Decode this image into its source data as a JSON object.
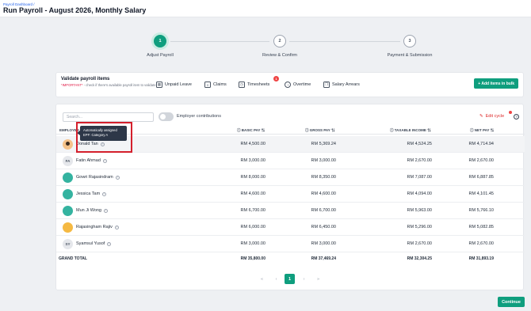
{
  "header": {
    "breadcrumb": "Payroll Dashboard /",
    "title": "Run Payroll - August 2026, Monthly Salary"
  },
  "stepper": [
    {
      "num": "1",
      "label": "Adjust Payroll",
      "state": "active"
    },
    {
      "num": "2",
      "label": "Review & Confirm",
      "state": "todo"
    },
    {
      "num": "3",
      "label": "Payment & Submission",
      "state": "todo"
    }
  ],
  "validate": {
    "title": "Validate payroll items",
    "note_important": "*IMPORTANT*",
    "note_text": " - check if there's available payroll item to validate",
    "items": [
      {
        "label": "Unpaid Leave",
        "icon": "calendar-icon"
      },
      {
        "label": "Claims",
        "icon": "receipt-icon"
      },
      {
        "label": "Timesheets",
        "icon": "clock-card-icon",
        "badge": "1"
      },
      {
        "label": "Overtime",
        "icon": "clock-icon"
      },
      {
        "label": "Salary Arrears",
        "icon": "stack-icon"
      }
    ],
    "bulk_button": "+ Add items in bulk"
  },
  "toolbar": {
    "search_placeholder": "Search...",
    "toggle_label": "Employer contributions",
    "edit_cycle": "Edit cycle",
    "help": "?"
  },
  "table": {
    "columns": [
      "EMPLOYEE",
      "BASIC PAY",
      "GROSS PAY",
      "TAXABLE INCOME",
      "NET PAY"
    ],
    "rows": [
      {
        "name": "Donald Tan",
        "avatar": "photo",
        "initials": "",
        "basic": "RM 4,500.00",
        "gross": "RM 5,369.24",
        "taxable": "RM 4,524.25",
        "net": "RM 4,714.94"
      },
      {
        "name": "Fatin Ahmad",
        "avatar": "initials",
        "initials": "FA",
        "basic": "RM 3,000.00",
        "gross": "RM 3,000.00",
        "taxable": "RM 2,670.00",
        "net": "RM 2,670.00"
      },
      {
        "name": "Gowri Rajasindram",
        "avatar": "teal",
        "initials": "",
        "basic": "RM 8,000.00",
        "gross": "RM 8,350.00",
        "taxable": "RM 7,087.00",
        "net": "RM 6,887.85"
      },
      {
        "name": "Jessica Tam",
        "avatar": "teal",
        "initials": "",
        "basic": "RM 4,600.00",
        "gross": "RM 4,600.00",
        "taxable": "RM 4,094.00",
        "net": "RM 4,101.45"
      },
      {
        "name": "Mun Ji Wong",
        "avatar": "teal",
        "initials": "",
        "basic": "RM 6,700.00",
        "gross": "RM 6,700.00",
        "taxable": "RM 5,963.00",
        "net": "RM 5,766.10"
      },
      {
        "name": "Rajasingham Rajiv",
        "avatar": "gold",
        "initials": "",
        "basic": "RM 6,000.00",
        "gross": "RM 6,450.00",
        "taxable": "RM 5,296.00",
        "net": "RM 5,082.85"
      },
      {
        "name": "Syamsul Yusof",
        "avatar": "initials",
        "initials": "SY",
        "basic": "RM 3,000.00",
        "gross": "RM 3,000.00",
        "taxable": "RM 2,670.00",
        "net": "RM 2,670.00"
      }
    ],
    "total": {
      "label": "GRAND TOTAL",
      "basic": "RM 35,800.00",
      "gross": "RM 37,469.24",
      "taxable": "RM 32,304.25",
      "net": "RM 31,893.19"
    }
  },
  "tooltip": {
    "line1": "Automatically assigned",
    "line2": "EPF: Category A"
  },
  "pager": {
    "first": "«",
    "prev": "‹",
    "current": "1",
    "next": "›",
    "last": "»"
  },
  "footer": {
    "continue": "Continue"
  },
  "colors": {
    "accent": "#0f9e7e",
    "danger": "#dc2626",
    "highlight": "#d41f2c"
  }
}
